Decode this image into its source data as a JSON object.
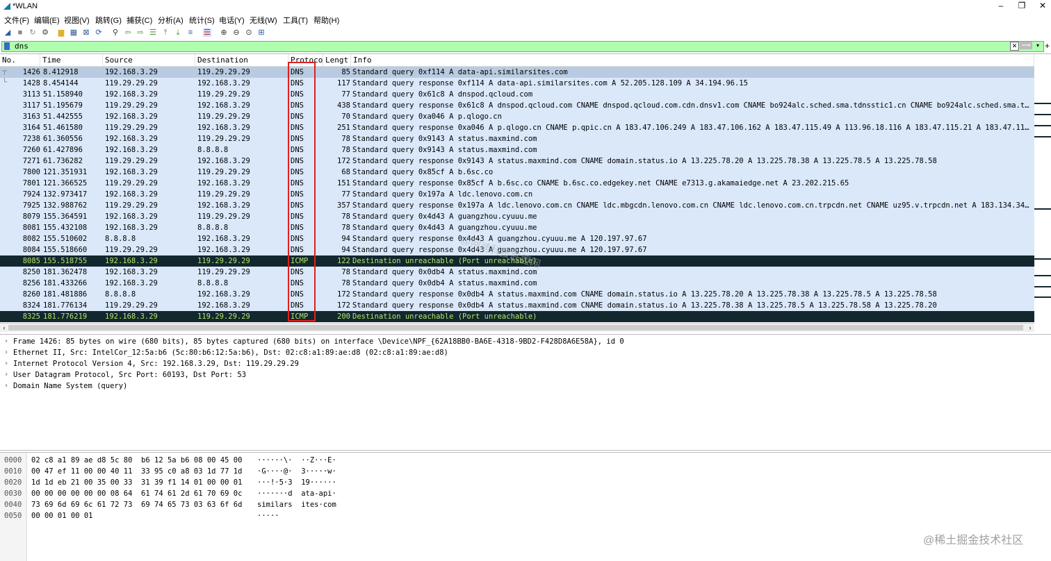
{
  "window": {
    "title": "*WLAN",
    "minimize": "–",
    "maximize": "❐",
    "close": "✕"
  },
  "menu": [
    {
      "label": "文件(F)"
    },
    {
      "label": "编辑(E)"
    },
    {
      "label": "视图(V)"
    },
    {
      "label": "跳转(G)"
    },
    {
      "label": "捕获(C)"
    },
    {
      "label": "分析(A)"
    },
    {
      "label": "统计(S)"
    },
    {
      "label": "电话(Y)"
    },
    {
      "label": "无线(W)"
    },
    {
      "label": "工具(T)"
    },
    {
      "label": "帮助(H)"
    }
  ],
  "toolbar_icons": [
    "shark-fin-start-icon",
    "stop-icon",
    "restart-icon",
    "options-icon",
    "open-file-icon",
    "save-file-icon",
    "close-file-icon",
    "reload-icon",
    "find-icon",
    "back-icon",
    "forward-icon",
    "go-to-packet-icon",
    "first-packet-icon",
    "last-packet-icon",
    "autoscroll-icon",
    "colorize-icon",
    "zoom-in-icon",
    "zoom-out-icon",
    "normal-size-icon",
    "resize-columns-icon"
  ],
  "filter": {
    "value": "dns",
    "clear": "✕",
    "apply": "⟶",
    "dropdown": "▾",
    "add": "+"
  },
  "packet_list": {
    "columns": [
      "No.",
      "Time",
      "Source",
      "Destination",
      "Protoco",
      "Lengt",
      "Info"
    ],
    "rows": [
      {
        "no": "1426",
        "time": "8.412918",
        "src": "192.168.3.29",
        "dst": "119.29.29.29",
        "proto": "DNS",
        "len": "85",
        "info": "Standard query 0xf114 A data-api.similarsites.com",
        "style": "sel"
      },
      {
        "no": "1428",
        "time": "8.454144",
        "src": "119.29.29.29",
        "dst": "192.168.3.29",
        "proto": "DNS",
        "len": "117",
        "info": "Standard query response 0xf114 A data-api.similarsites.com A 52.205.128.109 A 34.194.96.15",
        "style": "dns"
      },
      {
        "no": "3113",
        "time": "51.158940",
        "src": "192.168.3.29",
        "dst": "119.29.29.29",
        "proto": "DNS",
        "len": "77",
        "info": "Standard query 0x61c8 A dnspod.qcloud.com",
        "style": "dns"
      },
      {
        "no": "3117",
        "time": "51.195679",
        "src": "119.29.29.29",
        "dst": "192.168.3.29",
        "proto": "DNS",
        "len": "438",
        "info": "Standard query response 0x61c8 A dnspod.qcloud.com CNAME dnspod.qcloud.com.cdn.dnsv1.com CNAME bo924alc.sched.sma.tdnsstic1.cn CNAME bo924alc.sched.sma.t…",
        "style": "dns"
      },
      {
        "no": "3163",
        "time": "51.442555",
        "src": "192.168.3.29",
        "dst": "119.29.29.29",
        "proto": "DNS",
        "len": "70",
        "info": "Standard query 0xa046 A p.qlogo.cn",
        "style": "dns"
      },
      {
        "no": "3164",
        "time": "51.461580",
        "src": "119.29.29.29",
        "dst": "192.168.3.29",
        "proto": "DNS",
        "len": "251",
        "info": "Standard query response 0xa046 A p.qlogo.cn CNAME p.qpic.cn A 183.47.106.249 A 183.47.106.162 A 183.47.115.49 A 113.96.18.116 A 183.47.115.21 A 183.47.11…",
        "style": "dns"
      },
      {
        "no": "7238",
        "time": "61.360556",
        "src": "192.168.3.29",
        "dst": "119.29.29.29",
        "proto": "DNS",
        "len": "78",
        "info": "Standard query 0x9143 A status.maxmind.com",
        "style": "dns"
      },
      {
        "no": "7260",
        "time": "61.427896",
        "src": "192.168.3.29",
        "dst": "8.8.8.8",
        "proto": "DNS",
        "len": "78",
        "info": "Standard query 0x9143 A status.maxmind.com",
        "style": "dns"
      },
      {
        "no": "7271",
        "time": "61.736282",
        "src": "119.29.29.29",
        "dst": "192.168.3.29",
        "proto": "DNS",
        "len": "172",
        "info": "Standard query response 0x9143 A status.maxmind.com CNAME domain.status.io A 13.225.78.20 A 13.225.78.38 A 13.225.78.5 A 13.225.78.58",
        "style": "dns"
      },
      {
        "no": "7800",
        "time": "121.351931",
        "src": "192.168.3.29",
        "dst": "119.29.29.29",
        "proto": "DNS",
        "len": "68",
        "info": "Standard query 0x85cf A b.6sc.co",
        "style": "dns"
      },
      {
        "no": "7801",
        "time": "121.366525",
        "src": "119.29.29.29",
        "dst": "192.168.3.29",
        "proto": "DNS",
        "len": "151",
        "info": "Standard query response 0x85cf A b.6sc.co CNAME b.6sc.co.edgekey.net CNAME e7313.g.akamaiedge.net A 23.202.215.65",
        "style": "dns"
      },
      {
        "no": "7924",
        "time": "132.973417",
        "src": "192.168.3.29",
        "dst": "119.29.29.29",
        "proto": "DNS",
        "len": "77",
        "info": "Standard query 0x197a A ldc.lenovo.com.cn",
        "style": "dns"
      },
      {
        "no": "7925",
        "time": "132.988762",
        "src": "119.29.29.29",
        "dst": "192.168.3.29",
        "proto": "DNS",
        "len": "357",
        "info": "Standard query response 0x197a A ldc.lenovo.com.cn CNAME ldc.mbgcdn.lenovo.com.cn CNAME ldc.lenovo.com.cn.trpcdn.net CNAME uz95.v.trpcdn.net A 183.134.34…",
        "style": "dns"
      },
      {
        "no": "8079",
        "time": "155.364591",
        "src": "192.168.3.29",
        "dst": "119.29.29.29",
        "proto": "DNS",
        "len": "78",
        "info": "Standard query 0x4d43 A guangzhou.cyuuu.me",
        "style": "dns"
      },
      {
        "no": "8081",
        "time": "155.432108",
        "src": "192.168.3.29",
        "dst": "8.8.8.8",
        "proto": "DNS",
        "len": "78",
        "info": "Standard query 0x4d43 A guangzhou.cyuuu.me",
        "style": "dns"
      },
      {
        "no": "8082",
        "time": "155.510602",
        "src": "8.8.8.8",
        "dst": "192.168.3.29",
        "proto": "DNS",
        "len": "94",
        "info": "Standard query response 0x4d43 A guangzhou.cyuuu.me A 120.197.97.67",
        "style": "dns"
      },
      {
        "no": "8084",
        "time": "155.518660",
        "src": "119.29.29.29",
        "dst": "192.168.3.29",
        "proto": "DNS",
        "len": "94",
        "info": "Standard query response 0x4d43 A guangzhou.cyuuu.me A 120.197.97.67",
        "style": "dns"
      },
      {
        "no": "8085",
        "time": "155.518755",
        "src": "192.168.3.29",
        "dst": "119.29.29.29",
        "proto": "ICMP",
        "len": "122",
        "info": "Destination unreachable (Port unreachable)",
        "style": "icmp"
      },
      {
        "no": "8250",
        "time": "181.362478",
        "src": "192.168.3.29",
        "dst": "119.29.29.29",
        "proto": "DNS",
        "len": "78",
        "info": "Standard query 0x0db4 A status.maxmind.com",
        "style": "dns"
      },
      {
        "no": "8256",
        "time": "181.433266",
        "src": "192.168.3.29",
        "dst": "8.8.8.8",
        "proto": "DNS",
        "len": "78",
        "info": "Standard query 0x0db4 A status.maxmind.com",
        "style": "dns"
      },
      {
        "no": "8260",
        "time": "181.481886",
        "src": "8.8.8.8",
        "dst": "192.168.3.29",
        "proto": "DNS",
        "len": "172",
        "info": "Standard query response 0x0db4 A status.maxmind.com CNAME domain.status.io A 13.225.78.20 A 13.225.78.38 A 13.225.78.5 A 13.225.78.58",
        "style": "dns"
      },
      {
        "no": "8324",
        "time": "181.776134",
        "src": "119.29.29.29",
        "dst": "192.168.3.29",
        "proto": "DNS",
        "len": "172",
        "info": "Standard query response 0x0db4 A status.maxmind.com CNAME domain.status.io A 13.225.78.38 A 13.225.78.5 A 13.225.78.58 A 13.225.78.20",
        "style": "dns"
      },
      {
        "no": "8325",
        "time": "181.776219",
        "src": "192.168.3.29",
        "dst": "119.29.29.29",
        "proto": "ICMP",
        "len": "200",
        "info": "Destination unreachable (Port unreachable)",
        "style": "icmp"
      }
    ]
  },
  "details": [
    "Frame 1426: 85 bytes on wire (680 bits), 85 bytes captured (680 bits) on interface \\Device\\NPF_{62A18BB0-BA6E-4318-9BD2-F428D8A6E58A}, id 0",
    "Ethernet II, Src: IntelCor_12:5a:b6 (5c:80:b6:12:5a:b6), Dst: 02:c8:a1:89:ae:d8 (02:c8:a1:89:ae:d8)",
    "Internet Protocol Version 4, Src: 192.168.3.29, Dst: 119.29.29.29",
    "User Datagram Protocol, Src Port: 60193, Dst Port: 53",
    "Domain Name System (query)"
  ],
  "bytes": [
    {
      "offset": "0000",
      "hex": "02 c8 a1 89 ae d8 5c 80  b6 12 5a b6 08 00 45 00",
      "ascii": "······\\·  ··Z···E·"
    },
    {
      "offset": "0010",
      "hex": "00 47 ef 11 00 00 40 11  33 95 c0 a8 03 1d 77 1d",
      "ascii": "·G····@·  3·····w·"
    },
    {
      "offset": "0020",
      "hex": "1d 1d eb 21 00 35 00 33  31 39 f1 14 01 00 00 01",
      "ascii": "···!·5·3  19······"
    },
    {
      "offset": "0030",
      "hex": "00 00 00 00 00 00 08 64  61 74 61 2d 61 70 69 0c",
      "ascii": "·······d  ata-api·"
    },
    {
      "offset": "0040",
      "hex": "73 69 6d 69 6c 61 72 73  69 74 65 73 03 63 6f 6d",
      "ascii": "similars  ites·com"
    },
    {
      "offset": "0050",
      "hex": "00 00 01 00 01",
      "ascii": "·····"
    }
  ],
  "watermarks": {
    "corner": "@稀土掘金技术社区",
    "diagonal": "@阿迪科技联盟网"
  },
  "colors": {
    "dns_row": "#dae8fa",
    "selected_row": "#b8cbe0",
    "icmp_row_bg": "#12272e",
    "icmp_row_fg": "#b6e76b",
    "filter_ok": "#afffaf",
    "highlight_box": "#e02020"
  }
}
